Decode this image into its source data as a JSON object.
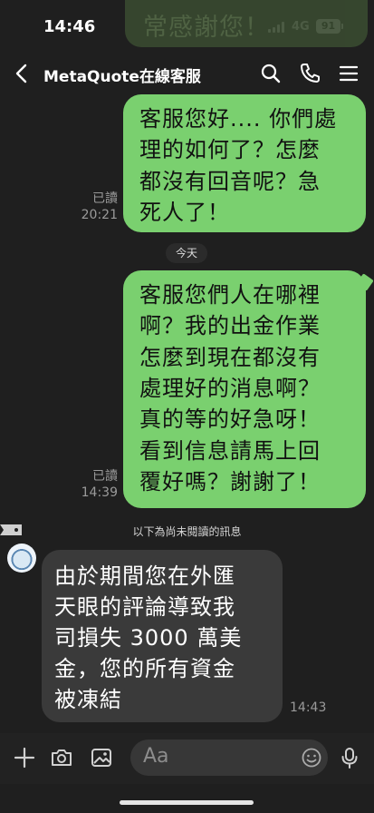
{
  "status_bar": {
    "time": "14:46",
    "network": "4G",
    "battery": "91"
  },
  "header": {
    "title": "MetaQuote在線客服"
  },
  "ghost_bubble_text": "常感謝您！",
  "messages": [
    {
      "direction": "out",
      "lines": [
        "客服您好.... 你們處",
        "理的如何了？怎麼",
        "都沒有回音呢？急",
        "死人了！"
      ],
      "read_label": "已讀",
      "time": "20:21"
    },
    {
      "direction": "out",
      "lines": [
        "客服您們人在哪裡",
        "啊？我的出金作業",
        "怎麼到現在都沒有",
        "處理好的消息啊？",
        "真的等的好急呀！",
        "看到信息請馬上回",
        "覆好嗎？謝謝了！"
      ],
      "read_label": "已讀",
      "time": "14:39"
    },
    {
      "direction": "in",
      "lines": [
        "由於期間您在外匯",
        "天眼的評論導致我",
        "司損失 3000 萬美",
        "金，您的所有資金",
        "被凍結"
      ],
      "time": "14:43"
    }
  ],
  "day_separator": "今天",
  "unread_divider": "以下為尚未閱讀的訊息",
  "input_bar": {
    "placeholder": "Aa"
  },
  "colors": {
    "outgoing_bubble": "#7ad06f",
    "incoming_bubble": "#3a3a3a",
    "background": "#1f1f1f"
  }
}
